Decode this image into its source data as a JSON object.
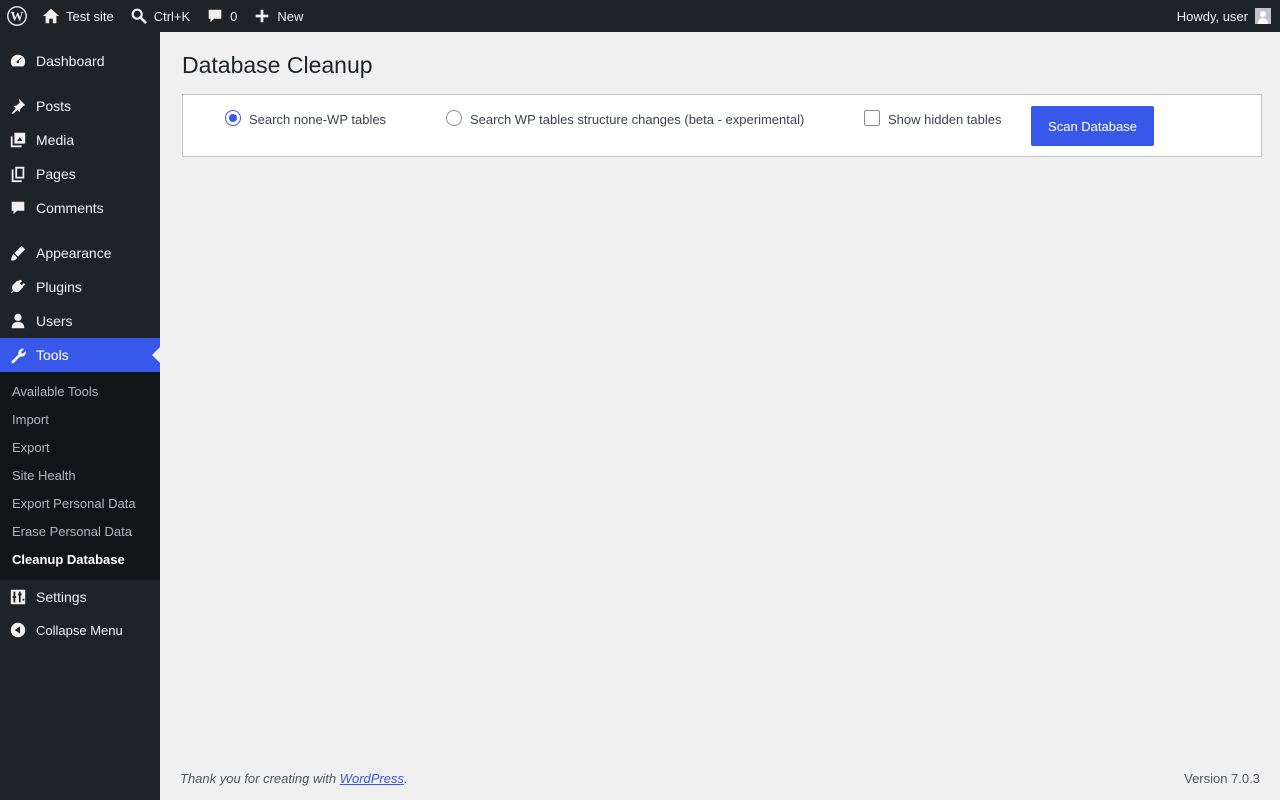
{
  "admin_bar": {
    "site_name": "Test site",
    "search_shortcut": "Ctrl+K",
    "comments_count": "0",
    "new_label": "New",
    "howdy": "Howdy, user"
  },
  "sidebar": {
    "items": [
      {
        "label": "Dashboard",
        "icon": "dashboard-icon"
      },
      {
        "label": "Posts",
        "icon": "pin-icon"
      },
      {
        "label": "Media",
        "icon": "media-icon"
      },
      {
        "label": "Pages",
        "icon": "pages-icon"
      },
      {
        "label": "Comments",
        "icon": "comment-icon"
      },
      {
        "label": "Appearance",
        "icon": "brush-icon"
      },
      {
        "label": "Plugins",
        "icon": "plug-icon"
      },
      {
        "label": "Users",
        "icon": "user-icon"
      },
      {
        "label": "Tools",
        "icon": "wrench-icon"
      },
      {
        "label": "Settings",
        "icon": "sliders-icon"
      }
    ],
    "submenu": [
      {
        "label": "Available Tools"
      },
      {
        "label": "Import"
      },
      {
        "label": "Export"
      },
      {
        "label": "Site Health"
      },
      {
        "label": "Export Personal Data"
      },
      {
        "label": "Erase Personal Data"
      },
      {
        "label": "Cleanup Database"
      }
    ],
    "collapse_label": "Collapse Menu"
  },
  "main": {
    "title": "Database Cleanup",
    "options": {
      "search_non_wp": "Search none-WP tables",
      "search_structure": "Search WP tables structure changes (beta - experimental)",
      "show_hidden": "Show hidden tables"
    },
    "scan_button": "Scan Database"
  },
  "footer": {
    "thanks_prefix": "Thank you for creating with ",
    "thanks_link": "WordPress",
    "thanks_suffix": ".",
    "version": "Version 7.0.3"
  },
  "colors": {
    "accent": "#3858e9",
    "admin_dark": "#1d2327",
    "submenu_bg": "#101517",
    "page_bg": "#f0f0f1"
  }
}
